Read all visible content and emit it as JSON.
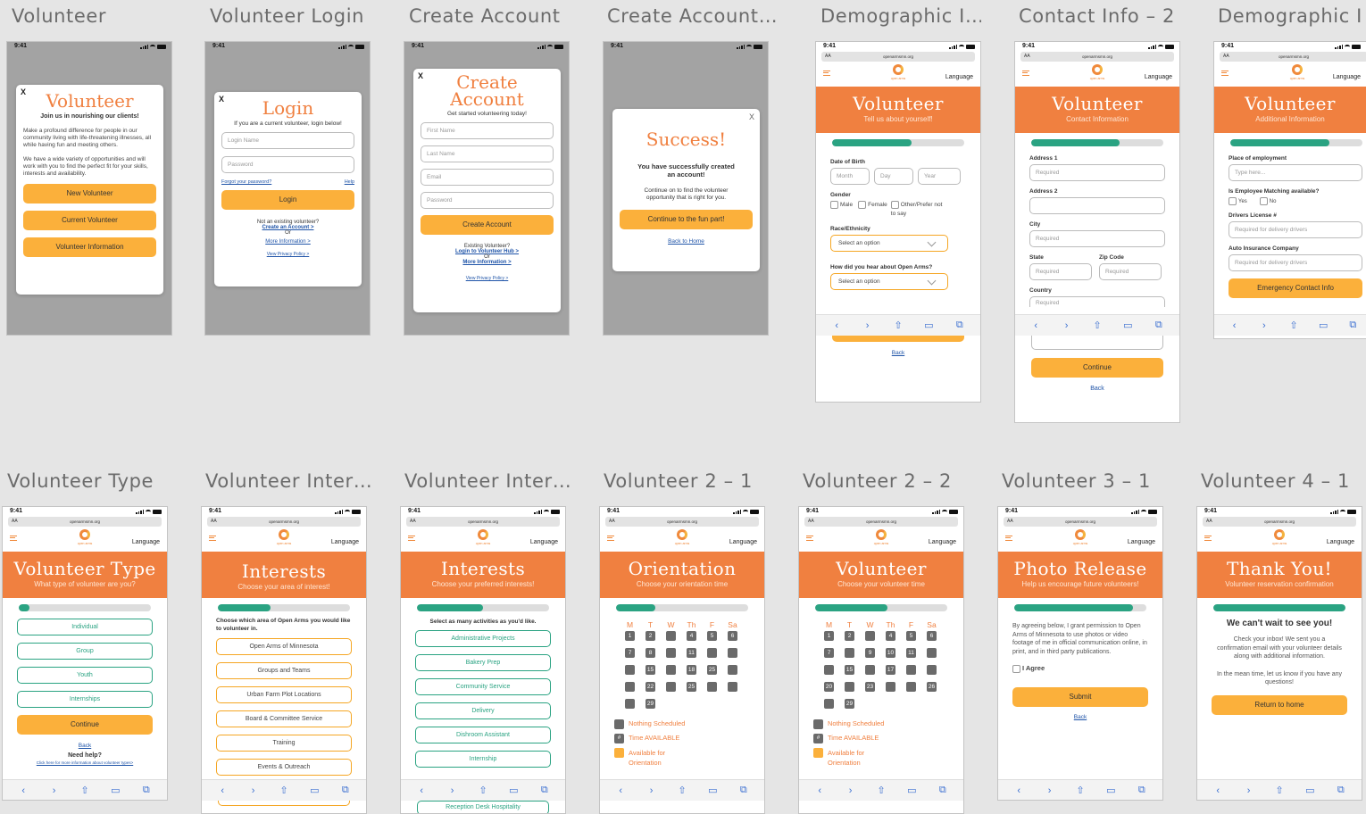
{
  "titles": [
    "Volunteer",
    "Volunteer Login",
    "Create Account",
    "Create Account…",
    "Demographic I…",
    "Contact Info – 2",
    "Demographic I…",
    "Volunteer Type",
    "Volunteer Inter…",
    "Volunteer Inter…",
    "Volunteer 2 – 1",
    "Volunteer 2 – 2",
    "Volunteer 3 – 1",
    "Volunteer 4 – 1"
  ],
  "status_time": "9:41",
  "url": "openarmsmn.org",
  "aa": "AA",
  "logo_text": "open arms",
  "language": "Language",
  "close": "X",
  "toolbar_icons": [
    "‹",
    "›",
    "⇧",
    "▭",
    "⧉"
  ],
  "s1": {
    "title": "Volunteer",
    "tagline": "Join us in nourishing our clients!",
    "p1": "Make a profound difference for people in our community living with life-threatening illnesses, all while having fun and meeting others.",
    "p2": "We have a wide variety of opportunities and will work with you to find the perfect fit for your skills, interests and availability.",
    "buttons": [
      "New Volunteer",
      "Current Volunteer",
      "Volunteer Information"
    ]
  },
  "s2": {
    "title": "Login",
    "sub": "If you are a current volunteer, login below!",
    "ph_login": "Login Name",
    "ph_password": "Password",
    "forgot": "Forgot your password?",
    "help": "Help",
    "button": "Login",
    "not_existing": "Not an existing volunteer?",
    "create": "Create an Account >",
    "or": "Or",
    "more": "More Information >",
    "privacy": "View Privacy Policy >"
  },
  "s3": {
    "title": "Create Account",
    "sub": "Get started volunteering today!",
    "fields": [
      "First Name",
      "Last Name",
      "Email",
      "Password"
    ],
    "button": "Create Account",
    "existing": "Existing Volunteer?",
    "hub": "Login to Volunteer Hub >",
    "or": "Or",
    "more": "More Information >",
    "privacy": "View Privacy Policy >"
  },
  "s4": {
    "title": "Success!",
    "msg": "You have successfully created an account!",
    "sub": "Continue on to find the volunteer opportunity that is right for you.",
    "button": "Continue to the fun part!",
    "back": "Back to Home"
  },
  "s5": {
    "hero": "Volunteer",
    "hero_sub": "Tell us about yourself!",
    "progress": 0.6,
    "dob": "Date of Birth",
    "month": "Month",
    "day": "Day",
    "year": "Year",
    "gender": "Gender",
    "male": "Male",
    "female": "Female",
    "other": "Other/Prefer not to say",
    "race": "Race/Ethnicity",
    "select": "Select an option",
    "hear": "How did you hear about Open Arms?",
    "select2": "Select an option",
    "back": "Back"
  },
  "s6": {
    "hero": "Volunteer",
    "hero_sub": "Contact Information",
    "progress": 0.67,
    "address1": "Address 1",
    "ph_required": "Required",
    "address2": "Address 2",
    "city": "City",
    "state": "State",
    "zip": "Zip Code",
    "country": "Country",
    "button": "Continue",
    "back": "Back"
  },
  "s7": {
    "hero": "Volunteer",
    "hero_sub": "Additional Information",
    "progress": 0.75,
    "employment": "Place of employment",
    "ph_type": "Type here...",
    "matching": "Is Employee Matching available?",
    "yes": "Yes",
    "no": "No",
    "license": "Drivers License #",
    "ph_delivery": "Required for delivery drivers",
    "insurance": "Auto Insurance Company",
    "button": "Emergency Contact Info"
  },
  "s8": {
    "hero": "Volunteer Type",
    "hero_sub": "What type of volunteer are you?",
    "progress": 0.08,
    "options": [
      "Individual",
      "Group",
      "Youth",
      "Internships"
    ],
    "button": "Continue",
    "back": "Back",
    "help": "Need help?",
    "help_link": "Click here for more information about volunteer types>"
  },
  "s9": {
    "hero": "Interests",
    "hero_sub": "Choose your area of interest!",
    "progress": 0.4,
    "intro": "Choose which area of Open Arms you would like to volunteer in.",
    "options": [
      "Open Arms of Minnesota",
      "Groups and Teams",
      "Urban Farm Plot Locations",
      "Board & Committee Service",
      "Training",
      "Events & Outreach"
    ]
  },
  "s10": {
    "hero": "Interests",
    "hero_sub": "Choose your preferred interests!",
    "progress": 0.5,
    "intro": "Select as many activities as you'd like.",
    "options": [
      "Administrative Projects",
      "Bakery Prep",
      "Community Service",
      "Delivery",
      "Dishroom Assistant",
      "Internship",
      "Reception Desk Hospitality"
    ]
  },
  "s11": {
    "hero": "Orientation",
    "hero_sub": "Choose your orientation time",
    "progress": 0.3,
    "days": [
      "M",
      "T",
      "W",
      "Th",
      "F",
      "Sa"
    ],
    "dates": [
      "1",
      "2",
      "",
      "4",
      "5",
      "6",
      "7",
      "8",
      "",
      "11",
      "",
      "",
      "",
      "15",
      "",
      "18",
      "25",
      "",
      "",
      "22",
      "",
      "25",
      "",
      "",
      "",
      "29",
      "",
      "",
      "",
      ""
    ],
    "legend": [
      "Nothing Scheduled",
      "Time AVAILABLE",
      "Available for Orientation"
    ],
    "legend_icon": "#"
  },
  "s12": {
    "hero": "Volunteer",
    "hero_sub": "Choose your volunteer time",
    "progress": 0.55,
    "days": [
      "M",
      "T",
      "W",
      "Th",
      "F",
      "Sa"
    ],
    "dates": [
      "1",
      "2",
      "",
      "4",
      "5",
      "6",
      "7",
      "",
      "9",
      "10",
      "11",
      "",
      "",
      "15",
      "",
      "17",
      "",
      "",
      "20",
      "",
      "23",
      "",
      "",
      "26",
      "",
      "29",
      "30",
      "",
      "",
      ""
    ],
    "legend": [
      "Nothing Scheduled",
      "Time AVAILABLE",
      "Available for Orientation"
    ],
    "legend_icon": "#"
  },
  "s13": {
    "hero": "Photo Release",
    "hero_sub": "Help us encourage future volunteers!",
    "progress": 0.9,
    "text": "By agreeing below, I grant permission to Open Arms of Minnesota to use photos or video footage of me in official communication online, in print, and in third party publications.",
    "agree": "I Agree",
    "button": "Submit",
    "back": "Back"
  },
  "s14": {
    "hero": "Thank You!",
    "hero_sub": "Volunteer reservation confirmation",
    "progress": 1,
    "heading": "We can't wait to see you!",
    "p1": "Check your inbox! We sent you a confirmation email with your volunteer details along with additional information.",
    "p2": "In the mean time, let us know if you have any questions!",
    "button": "Return to home"
  },
  "colors": {
    "orange": "#f08040",
    "yellow": "#fbb03b",
    "teal": "#2aa382",
    "link": "#1f54a8"
  }
}
